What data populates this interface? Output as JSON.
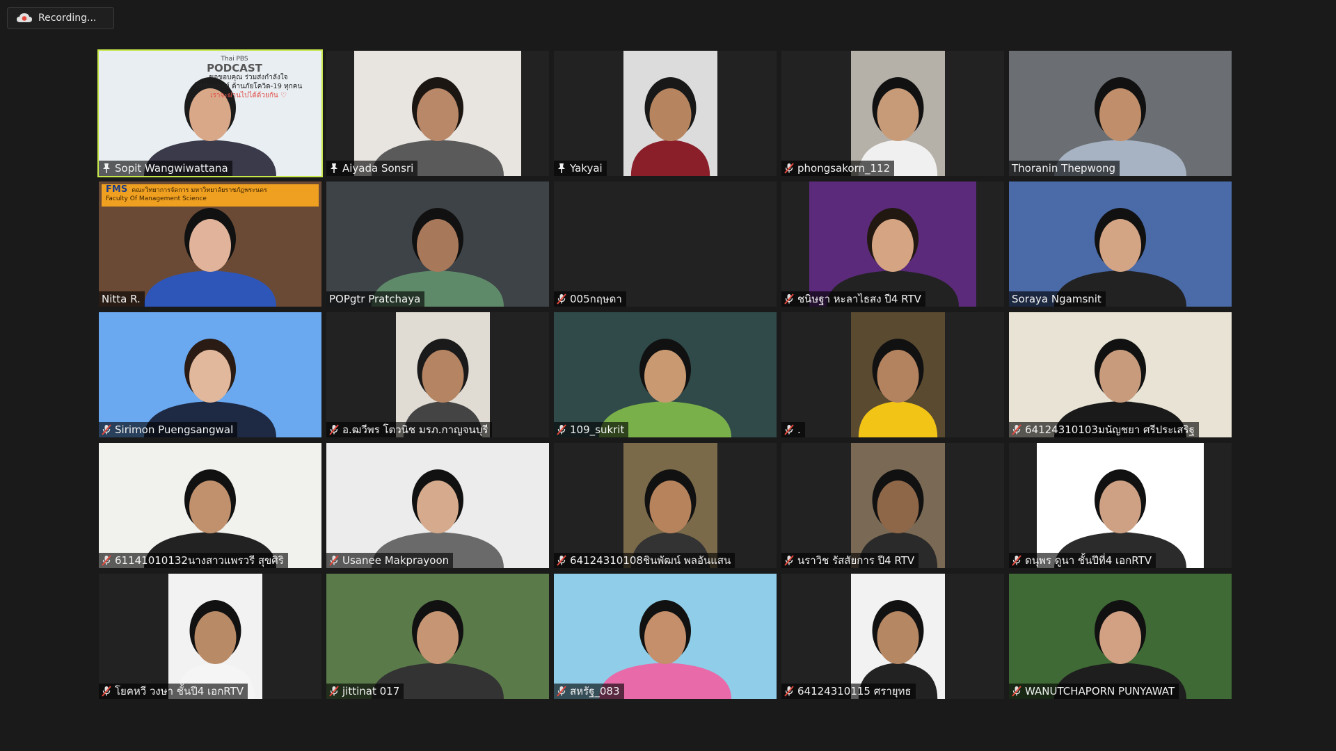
{
  "recording": {
    "label": "Recording..."
  },
  "participants": [
    {
      "name": "Sopit Wangwiwattana",
      "state": "pin",
      "active": true,
      "bg": "#e9eef2",
      "skin": "#d9a888",
      "shirt": "#3a3a4a",
      "hair": "#1b1b1b",
      "frame": "full",
      "overlay": {
        "brand": "Thai PBS",
        "title": "PODCAST",
        "line1": "ขอขอบคุณ ร่วมส่งกำลังใจ",
        "line2": "ให้ทีมแพทย์ ต้านภัยโควิด-19 ทุกคน",
        "line3": "เราจะผ่านไปได้ด้วยกัน ♡"
      }
    },
    {
      "name": "Aiyada Sonsri",
      "state": "pin",
      "active": false,
      "bg": "#e8e4df",
      "skin": "#b98868",
      "shirt": "#5a5a5a",
      "hair": "#1c1612",
      "frame": "center"
    },
    {
      "name": "Yakyai",
      "state": "pin",
      "active": false,
      "bg": "#dcdcdc",
      "skin": "#b6855f",
      "shirt": "#8a1f2a",
      "hair": "#181818",
      "frame": "narrow"
    },
    {
      "name": "phongsakorn_112",
      "state": "muted",
      "active": false,
      "bg": "#b5b0a8",
      "skin": "#c79a78",
      "shirt": "#f0f0f0",
      "hair": "#111",
      "frame": "narrow"
    },
    {
      "name": "Thoranin Thepwong",
      "state": "none",
      "active": false,
      "bg": "#6b6f73",
      "skin": "#c08e6a",
      "shirt": "#a7b3c2",
      "hair": "#111",
      "frame": "full"
    },
    {
      "name": "Nitta R.",
      "state": "none",
      "active": false,
      "bg": "#6b4a35",
      "skin": "#e0b39a",
      "shirt": "#2d56b8",
      "hair": "#111",
      "frame": "full",
      "overlay": {
        "brand": "FMS",
        "title": "คณะวิทยาการจัดการ มหาวิทยาลัยราชภัฏพระนคร",
        "line1": "Faculty Of Management Science"
      }
    },
    {
      "name": "POPgtr Pratchaya",
      "state": "none",
      "active": false,
      "bg": "#3e4347",
      "skin": "#a8785a",
      "shirt": "#5f8a6a",
      "hair": "#111",
      "frame": "full"
    },
    {
      "name": "005กฤษดา",
      "state": "muted",
      "active": false,
      "bg": "#1f1f1f",
      "skin": "",
      "shirt": "",
      "hair": "",
      "frame": "empty"
    },
    {
      "name": "ชนิษฐา หะลาไธสง ปี4 RTV",
      "state": "muted",
      "active": false,
      "bg": "#5b2a7a",
      "skin": "#d5a483",
      "shirt": "#222",
      "hair": "#221812",
      "frame": "center"
    },
    {
      "name": "Soraya Ngamsnit",
      "state": "none",
      "active": false,
      "bg": "#4a6aa8",
      "skin": "#d4a585",
      "shirt": "#222",
      "hair": "#111",
      "frame": "full"
    },
    {
      "name": "Sirimon Puengsangwal",
      "state": "muted",
      "active": false,
      "bg": "#6aa8f0",
      "skin": "#e2b89c",
      "shirt": "#1e2a44",
      "hair": "#2a1c14",
      "frame": "full"
    },
    {
      "name": "อ.ฒวีพร โตวนิช มรภ.กาญจนบุรี",
      "state": "muted",
      "active": false,
      "bg": "#e0dcd4",
      "skin": "#b58462",
      "shirt": "#444",
      "hair": "#1a1a1a",
      "frame": "narrow"
    },
    {
      "name": "109_sukrit",
      "state": "muted",
      "active": false,
      "bg": "#304a4a",
      "skin": "#c99a72",
      "shirt": "#7ab04a",
      "hair": "#111",
      "frame": "full"
    },
    {
      "name": ".",
      "state": "muted",
      "active": false,
      "bg": "#5a4a30",
      "skin": "#b3825e",
      "shirt": "#f2c416",
      "hair": "#111",
      "frame": "narrow"
    },
    {
      "name": "64124310103มนัญชยา ศรีประเสริฐ",
      "state": "muted",
      "active": false,
      "bg": "#e8e3d4",
      "skin": "#c79b7c",
      "shirt": "#1a1a1a",
      "hair": "#111",
      "frame": "full"
    },
    {
      "name": "61141010132นางสาวแพรวรี สุขศิริ",
      "state": "muted",
      "active": false,
      "bg": "#f1f1ee",
      "skin": "#c1916d",
      "shirt": "#222",
      "hair": "#111",
      "frame": "full"
    },
    {
      "name": "Usanee Makprayoon",
      "state": "muted",
      "active": false,
      "bg": "#ececec",
      "skin": "#d6aa8c",
      "shirt": "#6a6a6a",
      "hair": "#111",
      "frame": "full"
    },
    {
      "name": "64124310108ชินพัฒน์ พลอันแสน",
      "state": "muted",
      "active": false,
      "bg": "#7a6a4a",
      "skin": "#b7835c",
      "shirt": "#333",
      "hair": "#111",
      "frame": "narrow"
    },
    {
      "name": "นราวิช รัสสัยการ ปี4 RTV",
      "state": "muted",
      "active": false,
      "bg": "#7a6a55",
      "skin": "#8e6648",
      "shirt": "#2a2a2a",
      "hair": "#111",
      "frame": "narrow"
    },
    {
      "name": "ดนุพร ดูนา ชั้นปีที่4 เอกRTV",
      "state": "muted",
      "active": false,
      "bg": "#ffffff",
      "skin": "#cfa184",
      "shirt": "#2b2b2b",
      "hair": "#111",
      "frame": "center"
    },
    {
      "name": "โยคหวี วงษา ชั้นปี4 เอกRTV",
      "state": "muted",
      "active": false,
      "bg": "#f2f2f2",
      "skin": "#b98a66",
      "shirt": "#f5f5f5",
      "hair": "#111",
      "frame": "narrow"
    },
    {
      "name": "jittinat 017",
      "state": "muted",
      "active": false,
      "bg": "#5a7a4a",
      "skin": "#c69574",
      "shirt": "#333",
      "hair": "#111",
      "frame": "full"
    },
    {
      "name": "สหรัฐ_083",
      "state": "muted",
      "active": false,
      "bg": "#8fcde8",
      "skin": "#c48f6a",
      "shirt": "#e86aa8",
      "hair": "#111",
      "frame": "full"
    },
    {
      "name": "64124310115 ศรายุทธ",
      "state": "muted",
      "active": false,
      "bg": "#f2f2f2",
      "skin": "#b68763",
      "shirt": "#222",
      "hair": "#111",
      "frame": "narrow"
    },
    {
      "name": "WANUTCHAPORN PUNYAWAT",
      "state": "muted",
      "active": false,
      "bg": "#3f6a35",
      "skin": "#d2a184",
      "shirt": "#1e1e1e",
      "hair": "#111",
      "frame": "full"
    }
  ]
}
